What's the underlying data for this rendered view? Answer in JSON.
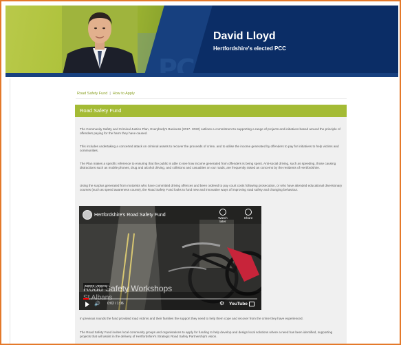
{
  "header": {
    "name": "David Lloyd",
    "subtitle": "Hertfordshire's elected PCC",
    "watermark": "PC"
  },
  "breadcrumb": {
    "items": [
      "Road Safety Fund",
      "How to Apply"
    ],
    "separator": "|"
  },
  "section": {
    "title": "Road Safety Fund"
  },
  "content": {
    "paragraphs": [
      "The Community Safety and Criminal Justice Plan, Everybody's Business (2017- 2022) outlines a commitment to supporting a range of projects and initiatives based around the principle of offenders paying for the harm they have caused.",
      "This includes undertaking a concerted attack on criminal assets to recover the proceeds of crime, and to utilise the income generated by offenders to pay for initiatives to help victims and communities.",
      "The Plan makes a specific reference to ensuring that the public is able to see how income generated from offenders is being spent. Anti-social driving, such as speeding, those causing distractions such as mobile phones, drug and alcohol driving, and collisions and casualties on our roads, are frequently raised as concerns by the residents of Hertfordshire.",
      "Using the surplus generated from motorists who have committed driving offences and been ordered to pay court costs following prosecution, or who have attended educational diversionary courses (such as speed awareness course), the Road Safety Fund looks to fund new and innovative ways of improving road safety and changing behaviour.",
      "In previous rounds the fund provided road victims and their families the support they need to help them cope and recover from the crime they have experienced.",
      "The Road Safety Fund invites local community groups and organisations to apply for funding to help develop and design local solutions where a need has been identified, supporting projects that will assist in the delivery of Hertfordshire's Strategic Road Safety Partnership's vision."
    ]
  },
  "video": {
    "title": "Hertfordshire's Road Safety Fund",
    "watch_later": "Watch later",
    "share": "Share",
    "more_videos": "MORE VIDEOS",
    "overlay_line1": "Road Safety Workshops",
    "overlay_line2": "St Albans",
    "time": "0:02 / 1:06",
    "progress": 0.03,
    "youtube_label": "YouTube"
  },
  "colors": {
    "accent_green": "#a4bb35",
    "header_navy": "#0b2d66",
    "frame_orange": "#e4792a"
  }
}
